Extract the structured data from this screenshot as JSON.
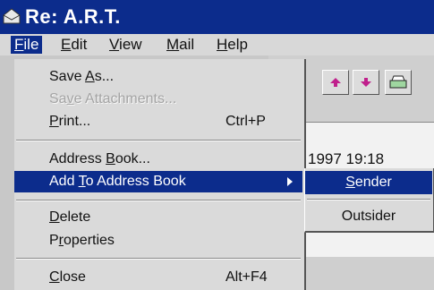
{
  "window": {
    "title": "Re: A.R.T."
  },
  "menubar": {
    "items": [
      {
        "label": "File",
        "accel": "F"
      },
      {
        "label": "Edit",
        "accel": "E"
      },
      {
        "label": "View",
        "accel": "V"
      },
      {
        "label": "Mail",
        "accel": "M"
      },
      {
        "label": "Help",
        "accel": "H"
      }
    ]
  },
  "file_menu": {
    "save_as": {
      "pre": "Save ",
      "accel": "A",
      "post": "s..."
    },
    "save_attachments": {
      "pre": "Sa",
      "accel": "v",
      "post": "e Attachments..."
    },
    "print": {
      "pre": "",
      "accel": "P",
      "post": "rint...",
      "shortcut": "Ctrl+P"
    },
    "address_book": {
      "pre": "Address ",
      "accel": "B",
      "post": "ook..."
    },
    "add_to_address_book": {
      "pre": "Add ",
      "accel": "T",
      "post": "o Address Book"
    },
    "delete": {
      "pre": "",
      "accel": "D",
      "post": "elete"
    },
    "properties": {
      "pre": "P",
      "accel": "r",
      "post": "operties"
    },
    "close": {
      "pre": "",
      "accel": "C",
      "post": "lose",
      "shortcut": "Alt+F4"
    }
  },
  "submenu": {
    "sender": {
      "pre": "",
      "accel": "S",
      "post": "ender"
    },
    "outsider": {
      "label": "Outsider"
    }
  },
  "message": {
    "date": "1997 19:18"
  },
  "colors": {
    "title_bar": "#0c2c8c",
    "highlight": "#0c2c8c",
    "menu_background": "#dadada",
    "arrow_icon": "#c0208c"
  }
}
